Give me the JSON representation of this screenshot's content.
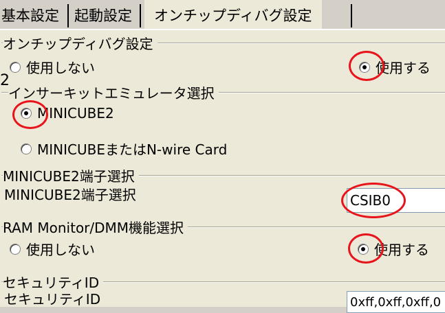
{
  "tabs": [
    {
      "label": "基本設定"
    },
    {
      "label": "起動設定"
    },
    {
      "label": "オンチップディバグ設定"
    }
  ],
  "side_marker": "2",
  "groups": {
    "onchip_debug": {
      "title": "オンチップディバグ設定",
      "option_off": "使用しない",
      "option_on": "使用する",
      "selected": "使用する"
    },
    "emulator": {
      "title": "インサーキットエミュレータ選択",
      "option1": "MINICUBE2",
      "option2": "MINICUBEまたはN-wire Card",
      "selected": "MINICUBE2"
    },
    "terminal": {
      "title": "MINICUBE2端子選択",
      "label": "MINICUBE2端子選択",
      "value": "CSIB0"
    },
    "ram_monitor": {
      "title": "RAM Monitor/DMM機能選択",
      "option_off": "使用しない",
      "option_on": "使用する",
      "selected": "使用する"
    },
    "security": {
      "title": "セキュリティID",
      "label": "セキュリティID",
      "value": "0xff,0xff,0xff,0"
    }
  },
  "colors": {
    "highlight": "#e8141c",
    "panel": "#ece9d8"
  }
}
